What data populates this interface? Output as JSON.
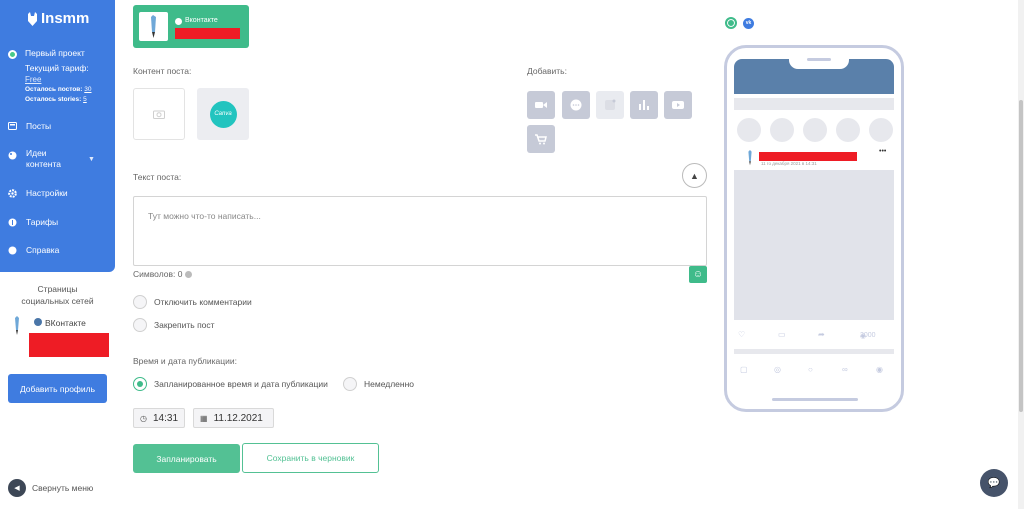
{
  "sidebar": {
    "logo_text": "Insmm",
    "project": {
      "name": "Первый проект",
      "plan_label": "Текущий тариф:",
      "plan_value": "Free",
      "posts_left_label": "Осталось постов:",
      "posts_left_value": "30",
      "stories_left_label": "Осталось stories:",
      "stories_left_value": "5"
    },
    "items": [
      {
        "label": "Посты",
        "icon": "posts-icon"
      },
      {
        "label": "Идеи контента",
        "icon": "palette-icon"
      },
      {
        "label": "Настройки",
        "icon": "gear-icon"
      },
      {
        "label": "Тарифы",
        "icon": "tariff-icon"
      },
      {
        "label": "Справка",
        "icon": "help-icon"
      }
    ],
    "pages_title_1": "Страницы",
    "pages_title_2": "социальных сетей",
    "vk_label": "ВКонтакте",
    "add_profile": "Добавить профиль",
    "collapse": "Свернуть меню"
  },
  "main": {
    "vk_card_label": "Вконтакте",
    "content_label": "Контент поста:",
    "add_label": "Добавить:",
    "canva_text": "Canva",
    "add_buttons": [
      "video-icon",
      "comment-icon",
      "stories-icon",
      "chart-icon",
      "youtube-icon",
      "cart-icon"
    ],
    "text_label": "Текст поста:",
    "text_placeholder": "Тут можно что-то написать...",
    "symbols_label": "Символов: 0",
    "disable_comments": "Отключить комментарии",
    "pin_post": "Закрепить пост",
    "publish_label": "Время и дата публикации:",
    "scheduled": "Запланированное время и дата публикации",
    "immediately": "Немедленно",
    "time": "14:31",
    "date": "11.12.2021",
    "schedule_button": "Запланировать",
    "draft_button": "Сохранить в черновик"
  },
  "preview": {
    "vk_badge": "vk",
    "post_date": "11 го декабря 2021 в 14:31",
    "views": "2000"
  },
  "colors": {
    "sidebar_blue": "#3f7ce0",
    "green": "#53c194",
    "redact": "#ee1c25"
  }
}
